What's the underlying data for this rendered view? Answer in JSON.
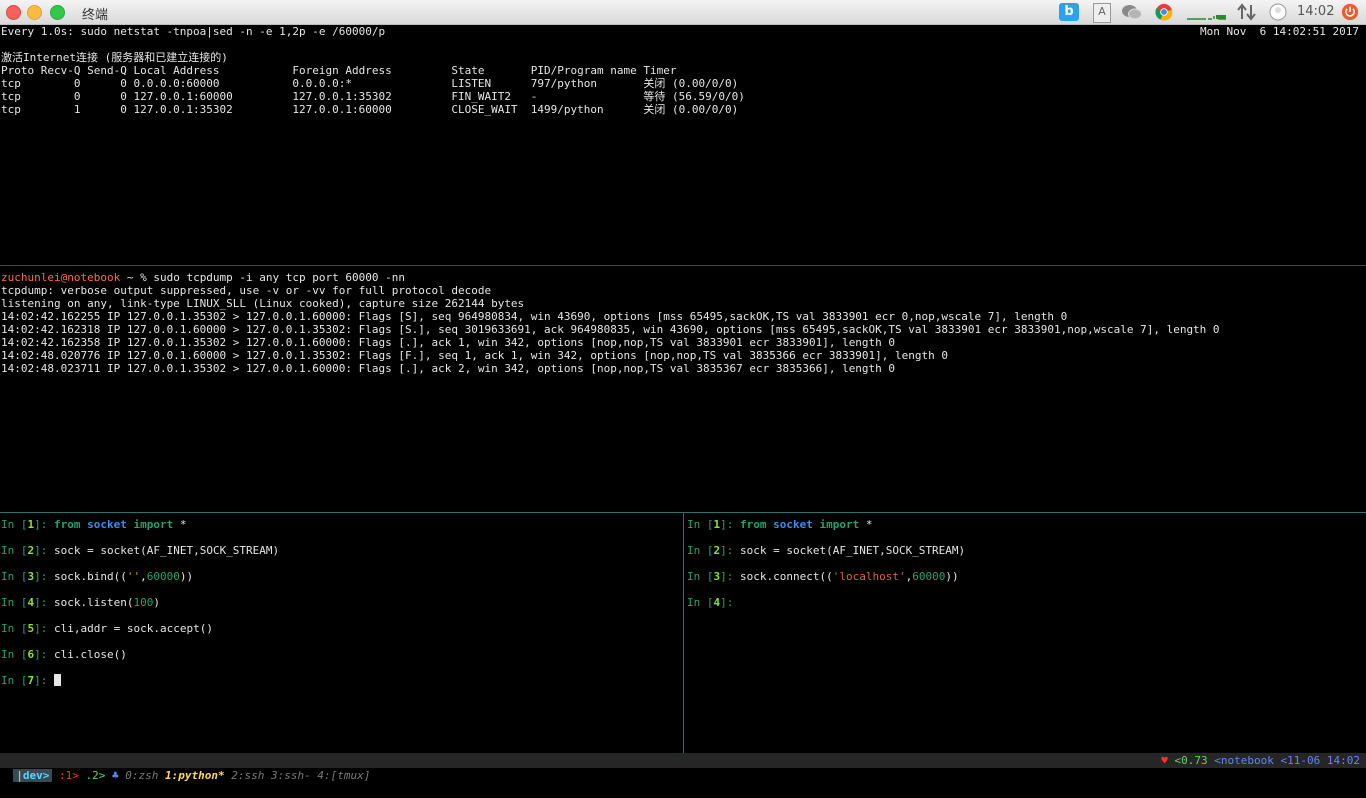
{
  "window": {
    "title": "终端"
  },
  "tray": {
    "app_letter": "b",
    "a_label": "A",
    "clock": "14:02"
  },
  "watch": {
    "header": "Every 1.0s: sudo netstat -tnpoa|sed -n -e 1,2p -e /60000/p",
    "date": "Mon Nov  6 14:02:51 2017",
    "lines": [
      "激活Internet连接 (服务器和已建立连接的)",
      "Proto Recv-Q Send-Q Local Address           Foreign Address         State       PID/Program name Timer",
      "tcp        0      0 0.0.0.0:60000           0.0.0.0:*               LISTEN      797/python       关闭 (0.00/0/0)",
      "tcp        0      0 127.0.0.1:60000         127.0.0.1:35302         FIN_WAIT2   -                等待 (56.59/0/0)",
      "tcp        1      0 127.0.0.1:35302         127.0.0.1:60000         CLOSE_WAIT  1499/python      关闭 (0.00/0/0)"
    ]
  },
  "tcpdump": {
    "prompt_user": "zuchunlei@notebook",
    "prompt_rest": " ~ % sudo tcpdump -i any tcp port 60000 -nn",
    "lines": [
      "tcpdump: verbose output suppressed, use -v or -vv for full protocol decode",
      "listening on any, link-type LINUX_SLL (Linux cooked), capture size 262144 bytes",
      "14:02:42.162255 IP 127.0.0.1.35302 > 127.0.0.1.60000: Flags [S], seq 964980834, win 43690, options [mss 65495,sackOK,TS val 3833901 ecr 0,nop,wscale 7], length 0",
      "14:02:42.162318 IP 127.0.0.1.60000 > 127.0.0.1.35302: Flags [S.], seq 3019633691, ack 964980835, win 43690, options [mss 65495,sackOK,TS val 3833901 ecr 3833901,nop,wscale 7], length 0",
      "14:02:42.162358 IP 127.0.0.1.35302 > 127.0.0.1.60000: Flags [.], ack 1, win 342, options [nop,nop,TS val 3833901 ecr 3833901], length 0",
      "14:02:48.020776 IP 127.0.0.1.60000 > 127.0.0.1.35302: Flags [F.], seq 1, ack 1, win 342, options [nop,nop,TS val 3835366 ecr 3833901], length 0",
      "14:02:48.023711 IP 127.0.0.1.35302 > 127.0.0.1.60000: Flags [.], ack 2, win 342, options [nop,nop,TS val 3835367 ecr 3835366], length 0"
    ]
  },
  "ipy_left": {
    "in_label": "In [",
    "in_close": "]: ",
    "cells": [
      {
        "n": "1",
        "parts": [
          [
            "kw",
            "from"
          ],
          [
            "t",
            " "
          ],
          [
            "mod",
            "socket"
          ],
          [
            "t",
            " "
          ],
          [
            "kw",
            "import"
          ],
          [
            "t",
            " *"
          ]
        ]
      },
      {
        "n": "2",
        "parts": [
          [
            "t",
            "sock = socket(AF_INET,SOCK_STREAM)"
          ]
        ]
      },
      {
        "n": "3",
        "parts": [
          [
            "t",
            "sock.bind(("
          ],
          [
            "str",
            "''"
          ],
          [
            "t",
            ","
          ],
          [
            "num",
            "60000"
          ],
          [
            "t",
            "))"
          ]
        ]
      },
      {
        "n": "4",
        "parts": [
          [
            "t",
            "sock.listen("
          ],
          [
            "num",
            "100"
          ],
          [
            "t",
            ")"
          ]
        ]
      },
      {
        "n": "5",
        "parts": [
          [
            "t",
            "cli,addr = sock.accept()"
          ]
        ]
      },
      {
        "n": "6",
        "parts": [
          [
            "t",
            "cli.close()"
          ]
        ]
      },
      {
        "n": "7",
        "parts": [],
        "cursor": true
      }
    ]
  },
  "ipy_right": {
    "in_label": "In [",
    "in_close": "]: ",
    "cells": [
      {
        "n": "1",
        "parts": [
          [
            "kw",
            "from"
          ],
          [
            "t",
            " "
          ],
          [
            "mod",
            "socket"
          ],
          [
            "t",
            " "
          ],
          [
            "kw",
            "import"
          ],
          [
            "t",
            " *"
          ]
        ]
      },
      {
        "n": "2",
        "parts": [
          [
            "t",
            "sock = socket(AF_INET,SOCK_STREAM)"
          ]
        ]
      },
      {
        "n": "3",
        "parts": [
          [
            "t",
            "sock.connect(("
          ],
          [
            "str2",
            "'localhost'"
          ],
          [
            "t",
            ","
          ],
          [
            "num",
            "60000"
          ],
          [
            "t",
            "))"
          ]
        ]
      },
      {
        "n": "4",
        "parts": []
      }
    ]
  },
  "status": {
    "session": "|dev>",
    "win_marker_red": ":1>",
    "win_marker_green": ".2>",
    "bell": "♣",
    "windows": [
      {
        "label": "0:zsh",
        "style": "gray"
      },
      {
        "label": "1:python*",
        "style": "yellow"
      },
      {
        "label": "2:ssh",
        "style": "gray"
      },
      {
        "label": "3:ssh-",
        "style": "gray"
      },
      {
        "label": "4:[tmux]",
        "style": "gray"
      }
    ],
    "heart": "♥",
    "load": "<0.73",
    "host": "<notebook",
    "datetime": "<11-06 14:02"
  }
}
